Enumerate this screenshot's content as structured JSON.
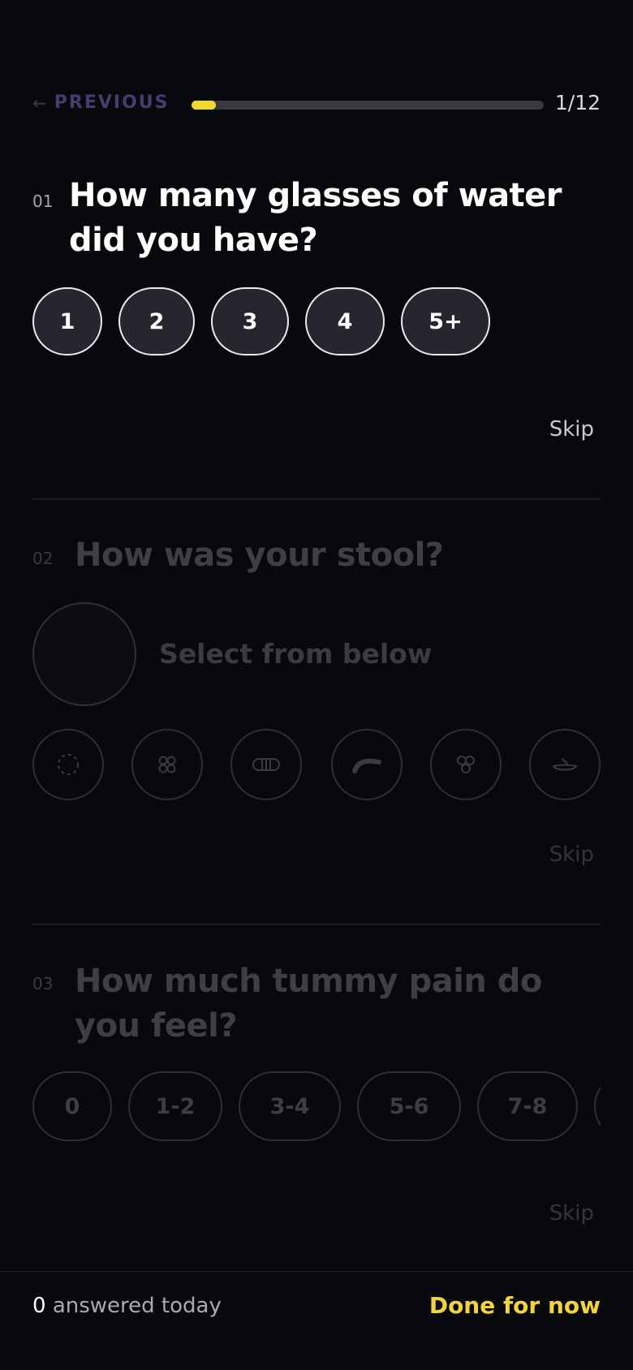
{
  "header": {
    "previous_label": "PREVIOUS",
    "progress_fraction": 0.0645,
    "counter": "1/12",
    "accent_color": "#f2d633"
  },
  "questions": [
    {
      "number": "01",
      "title": "How many glasses of water did you have?",
      "options": [
        "1",
        "2",
        "3",
        "4",
        "5+"
      ],
      "skip_label": "Skip"
    },
    {
      "number": "02",
      "title": "How was your stool?",
      "placeholder": "Select from below",
      "option_icons": [
        "stool-type-1-icon",
        "stool-type-2-icon",
        "stool-type-3-icon",
        "stool-type-4-icon",
        "stool-type-5-icon",
        "stool-type-6-icon"
      ],
      "skip_label": "Skip"
    },
    {
      "number": "03",
      "title": "How much tummy pain do you feel?",
      "options": [
        "0",
        "1-2",
        "3-4",
        "5-6",
        "7-8"
      ],
      "skip_label": "Skip"
    }
  ],
  "footer": {
    "answered_count": "0",
    "answered_text": "answered today",
    "done_label": "Done for now",
    "done_color": "#f4d43a"
  }
}
